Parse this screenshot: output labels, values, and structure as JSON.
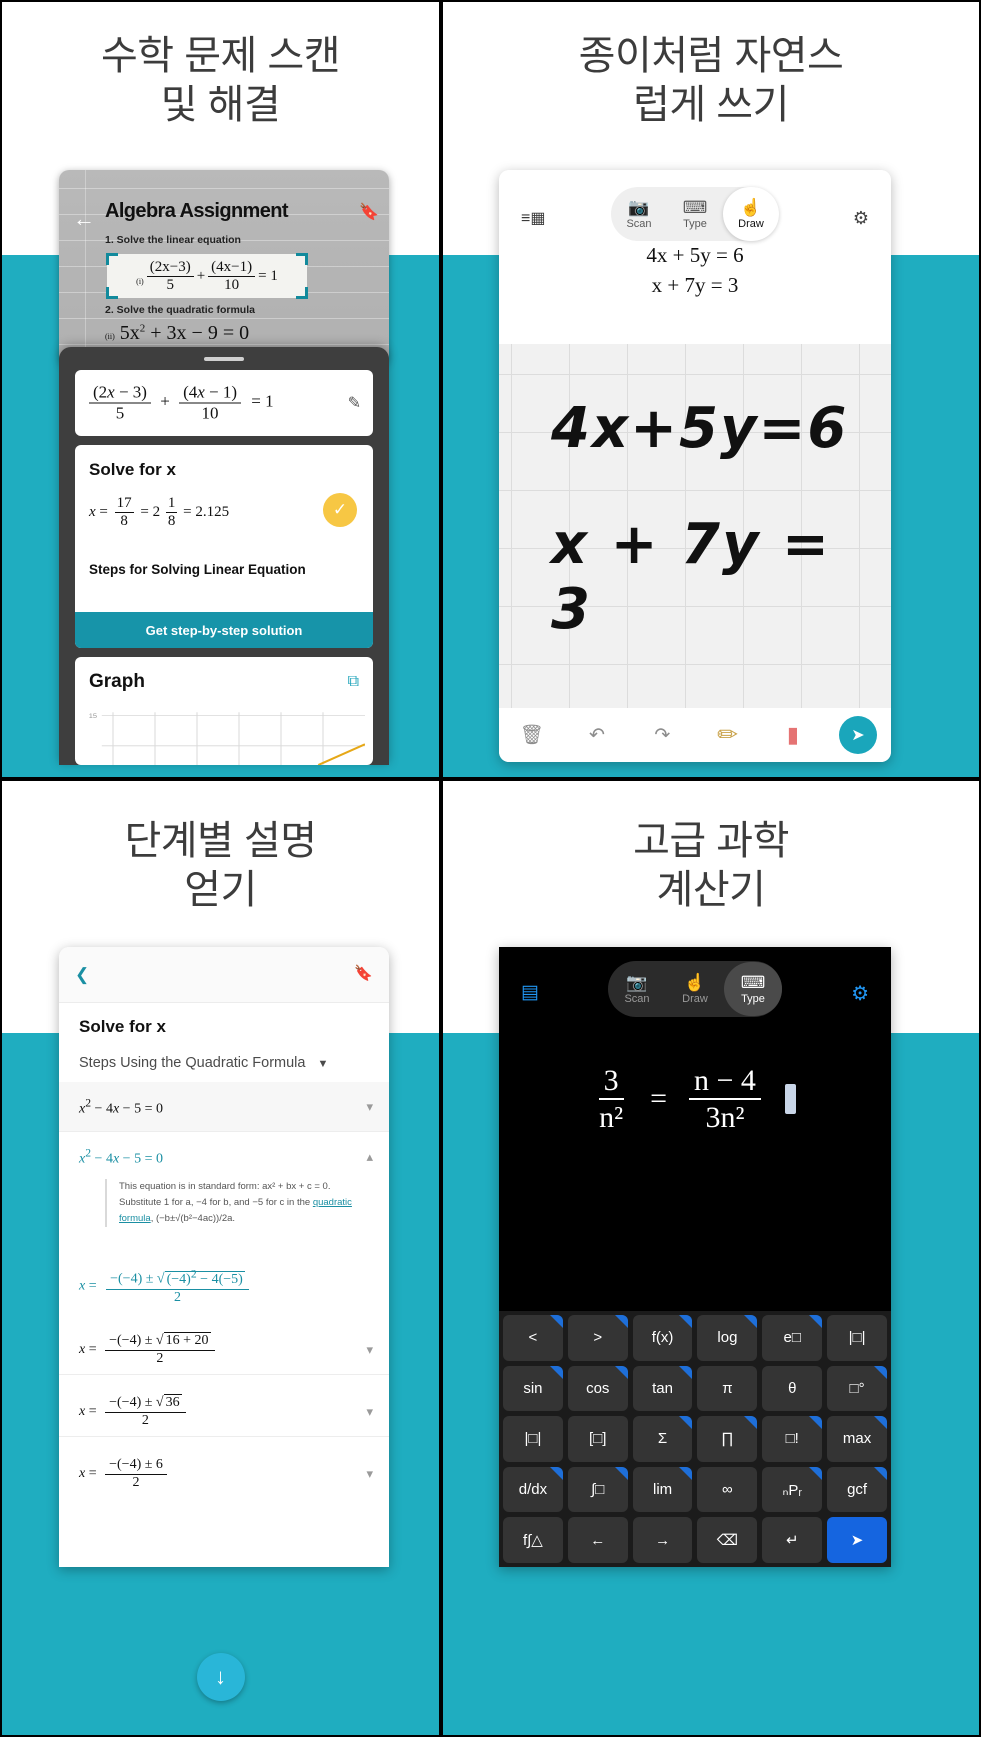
{
  "panels": [
    {
      "id": "panel-scan",
      "headline_line1": "수학 문제 스캔",
      "headline_line2": "및 해결",
      "scan": {
        "title": "Algebra Assignment",
        "back_icon": "back-arrow-icon",
        "bookmark_icon": "bookmark-icon",
        "question1": "1. Solve the linear equation",
        "equation1_label": "(i)",
        "equation1": "(2x−3)/5 + (4x−1)/10 = 1",
        "question2": "2. Solve the quadratic formula",
        "equation2_label": "(ii)",
        "equation2": "5x² + 3x − 9 = 0"
      },
      "sheet": {
        "input_equation": "(2x − 3)/5 + (4x − 1)/10 = 1",
        "edit_icon": "pencil-icon",
        "solve_title": "Solve for x",
        "answer": "x = 17/8 = 2 1/8 = 2.125",
        "check_icon": "check-circle-icon",
        "steps_label": "Steps for Solving Linear Equation",
        "cta_label": "Get step-by-step solution",
        "graph_title": "Graph",
        "expand_icon": "expand-icon",
        "graph_y_tick": "15"
      }
    },
    {
      "id": "panel-draw",
      "headline_line1": "종이처럼 자연스",
      "headline_line2": "럽게 쓰기",
      "list_icon": "list-icon",
      "gear_icon": "gear-icon",
      "modes": [
        {
          "label": "Scan",
          "icon": "camera-icon",
          "active": false
        },
        {
          "label": "Type",
          "icon": "keyboard-icon",
          "active": false
        },
        {
          "label": "Draw",
          "icon": "hand-draw-icon",
          "active": true
        }
      ],
      "typed_equations": [
        "4x + 5y = 6",
        "x + 7y = 3"
      ],
      "handwritten": [
        "4x+5y=6",
        "x + 7y = 3"
      ],
      "toolbar": [
        {
          "name": "trash-icon",
          "glyph": "🗑"
        },
        {
          "name": "undo-icon",
          "glyph": "↩"
        },
        {
          "name": "redo-icon",
          "glyph": "↪"
        },
        {
          "name": "pencil-tool-icon",
          "glyph": "✏"
        },
        {
          "name": "eraser-tool-icon",
          "glyph": "▯"
        }
      ],
      "send_icon": "send-icon"
    },
    {
      "id": "panel-steps",
      "headline_line1": "단계별 설명",
      "headline_line2": "얻기",
      "back_icon": "back-chevron-icon",
      "bookmark_icon": "bookmark-icon",
      "title": "Solve for x",
      "method_label": "Steps Using the Quadratic Formula",
      "method_caret": "▼",
      "steps": [
        {
          "equation": "x² − 4x − 5 = 0",
          "state": "collapsed",
          "highlight": false
        },
        {
          "equation": "x² − 4x − 5 = 0",
          "state": "expanded",
          "highlight": true
        },
        {
          "equation": "x = (−(−4) ± √((−4)² − 4(−5)))/2",
          "state": "plain",
          "highlight": true
        },
        {
          "equation": "x = (−(−4) ± √(16 + 20))/2",
          "state": "collapsed",
          "highlight": false
        },
        {
          "equation": "x = (−(−4) ± √36)/2",
          "state": "collapsed",
          "highlight": false
        },
        {
          "equation": "x = (−(−4) ± 6)/2",
          "state": "collapsed",
          "highlight": false
        }
      ],
      "explanation": {
        "part1": "This equation is in standard form: ax² + bx + c = 0. Substitute 1 for a, −4 for b, and −5 for c in the ",
        "link": "quadratic formula",
        "part2": ", (−b±√(b²−4ac))/2a."
      },
      "scroll_fab_icon": "arrow-down-icon"
    },
    {
      "id": "panel-calculator",
      "headline_line1": "고급 과학",
      "headline_line2": "계산기",
      "list_icon": "list-icon",
      "gear_icon": "gear-icon",
      "modes": [
        {
          "label": "Scan",
          "icon": "camera-icon",
          "active": false
        },
        {
          "label": "Draw",
          "icon": "hand-draw-icon",
          "active": false
        },
        {
          "label": "Type",
          "icon": "keyboard-icon",
          "active": true
        }
      ],
      "expression": {
        "left_num": "3",
        "left_den": "n²",
        "operator": "=",
        "right_num": "n − 4",
        "right_den": "3n²"
      },
      "keyboard_rows": [
        [
          {
            "label": "<",
            "corner": true
          },
          {
            "label": ">",
            "corner": true
          },
          {
            "label": "f(x)",
            "corner": true
          },
          {
            "label": "log",
            "corner": true
          },
          {
            "label": "e□",
            "corner": true
          },
          {
            "label": "|□|",
            "corner": false
          }
        ],
        [
          {
            "label": "sin",
            "corner": true
          },
          {
            "label": "cos",
            "corner": true
          },
          {
            "label": "tan",
            "corner": true
          },
          {
            "label": "π",
            "corner": false
          },
          {
            "label": "θ",
            "corner": false
          },
          {
            "label": "□°",
            "corner": true
          }
        ],
        [
          {
            "label": "|□|",
            "corner": false
          },
          {
            "label": "[□]",
            "corner": false
          },
          {
            "label": "Σ",
            "corner": true
          },
          {
            "label": "∏",
            "corner": true
          },
          {
            "label": "□!",
            "corner": true
          },
          {
            "label": "max",
            "corner": true
          }
        ],
        [
          {
            "label": "d/dx",
            "corner": true
          },
          {
            "label": "∫□",
            "corner": true
          },
          {
            "label": "lim",
            "corner": true
          },
          {
            "label": "∞",
            "corner": false
          },
          {
            "label": "ₙPᵣ",
            "corner": true
          },
          {
            "label": "gcf",
            "corner": true
          }
        ],
        [
          {
            "label": "f∫△",
            "corner": false
          },
          {
            "label": "←",
            "corner": false
          },
          {
            "label": "→",
            "corner": false
          },
          {
            "label": "⌫",
            "corner": false
          },
          {
            "label": "↵",
            "corner": false
          },
          {
            "label": "➤",
            "corner": false,
            "blue": true
          }
        ]
      ]
    }
  ],
  "colors": {
    "teal": "#1fadc0",
    "cta_teal": "#1794a9",
    "accent_blue": "#1565e0",
    "amber": "#f7c744",
    "dark_sheet": "#3e3e3e"
  }
}
